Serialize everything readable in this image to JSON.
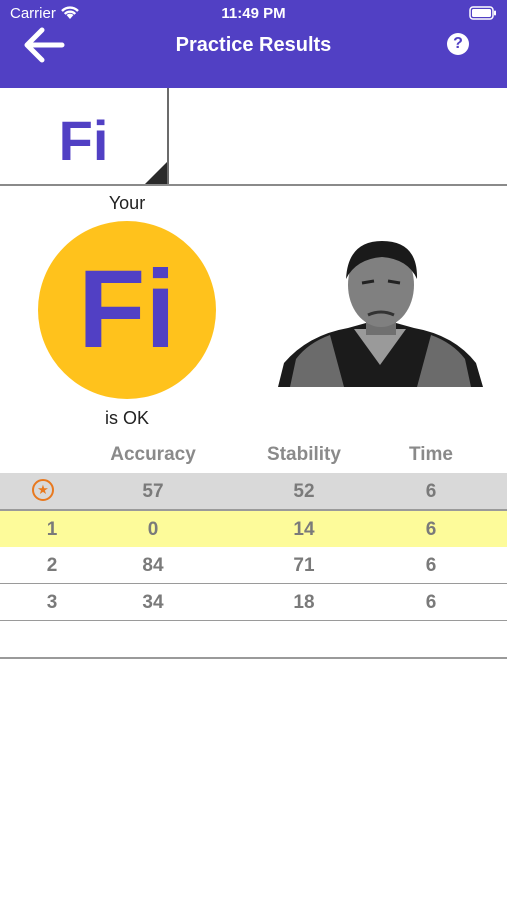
{
  "status_bar": {
    "carrier": "Carrier",
    "time": "11:49 PM"
  },
  "header": {
    "title": "Practice Results",
    "help": "?",
    "back_icon": "arrow-left-icon"
  },
  "tabs": [
    {
      "label": "Fi"
    }
  ],
  "result": {
    "your": "Your",
    "badge": "Fi",
    "status": "is OK",
    "badge_color": "#ffc21c",
    "accent_color": "#5140c4"
  },
  "table": {
    "headers": {
      "accuracy": "Accuracy",
      "stability": "Stability",
      "time": "Time"
    },
    "best": {
      "accuracy": "57",
      "stability": "52",
      "time": "6"
    },
    "rows": [
      {
        "index": "1",
        "accuracy": "0",
        "stability": "14",
        "time": "6"
      },
      {
        "index": "2",
        "accuracy": "84",
        "stability": "71",
        "time": "6"
      },
      {
        "index": "3",
        "accuracy": "34",
        "stability": "18",
        "time": "6"
      }
    ]
  }
}
